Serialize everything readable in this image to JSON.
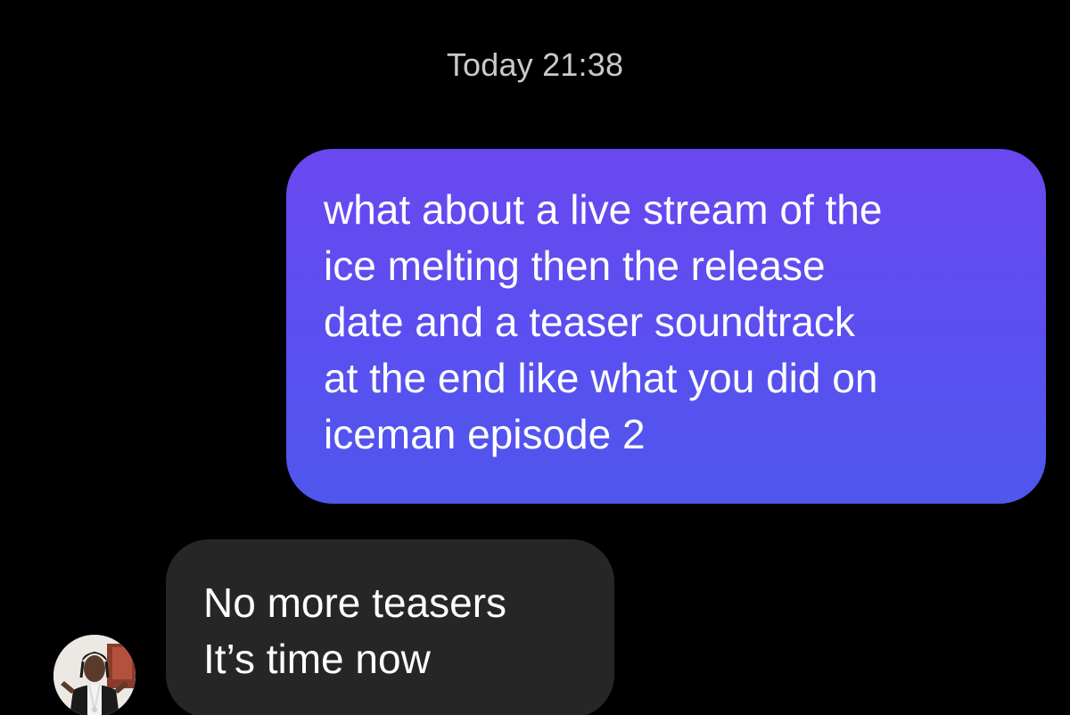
{
  "chat": {
    "timestamp": "Today 21:38",
    "messages": [
      {
        "direction": "sent",
        "lines": [
          "what about a live stream of the",
          "ice melting then the release",
          "date and a teaser soundtrack",
          "at the end like what you did on",
          "iceman episode 2"
        ]
      },
      {
        "direction": "received",
        "lines": [
          "No more teasers",
          "It’s time now"
        ]
      }
    ],
    "avatar_icon": "contact-avatar"
  },
  "colors": {
    "background": "#000000",
    "sent_bubble": "#5a4ff0",
    "received_bubble": "#262626",
    "timestamp_text": "#c9c9c9",
    "message_text": "#ffffff"
  }
}
